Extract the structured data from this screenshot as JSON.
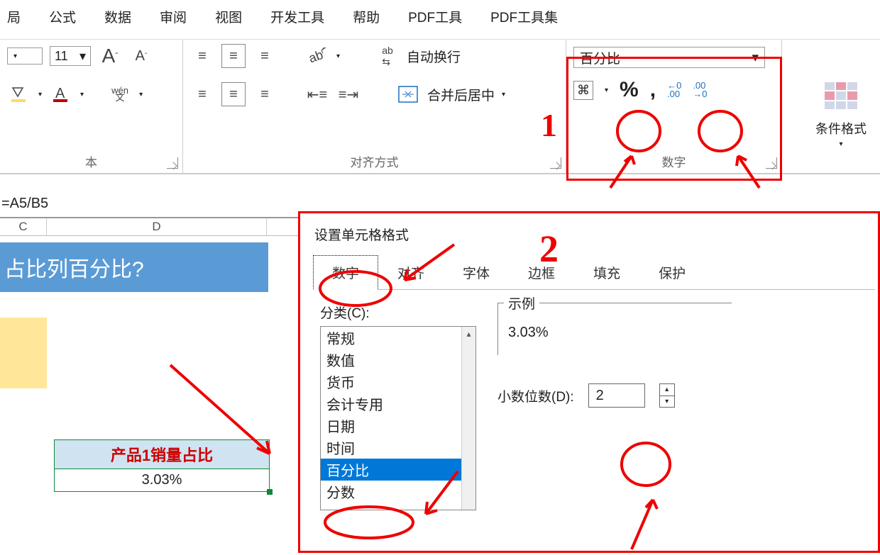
{
  "ribbon_tabs": [
    "局",
    "公式",
    "数据",
    "审阅",
    "视图",
    "开发工具",
    "帮助",
    "PDF工具",
    "PDF工具集"
  ],
  "font": {
    "size": "11",
    "grow": "A",
    "shrink": "A"
  },
  "alignment": {
    "group_label": "对齐方式",
    "wrap_text": "自动换行",
    "merge_center": "合并后居中"
  },
  "number": {
    "group_label": "数字",
    "format_selected": "百分比",
    "currency_glyph": "%",
    "comma": ",",
    "inc_dec": "←0\n.00",
    "dec_inc": ".00\n→0"
  },
  "cond_format_label": "条件格式",
  "group_below_left": "本",
  "formula_bar": "=A5/B5",
  "col_headers": {
    "c": "C",
    "d": "D"
  },
  "banner_text": "占比列百分比?",
  "mini_table": {
    "header": "产品1销量占比",
    "value": "3.03%"
  },
  "dialog": {
    "title": "设置单元格格式",
    "tabs": [
      "数字",
      "对齐",
      "字体",
      "边框",
      "填充",
      "保护"
    ],
    "category_label": "分类(C):",
    "categories": [
      "常规",
      "数值",
      "货币",
      "会计专用",
      "日期",
      "时间",
      "百分比",
      "分数"
    ],
    "selected_category_index": 6,
    "sample_label": "示例",
    "sample_value": "3.03%",
    "decimals_label": "小数位数(D):",
    "decimals_value": "2"
  },
  "annotations": {
    "one": "1",
    "two": "2"
  }
}
